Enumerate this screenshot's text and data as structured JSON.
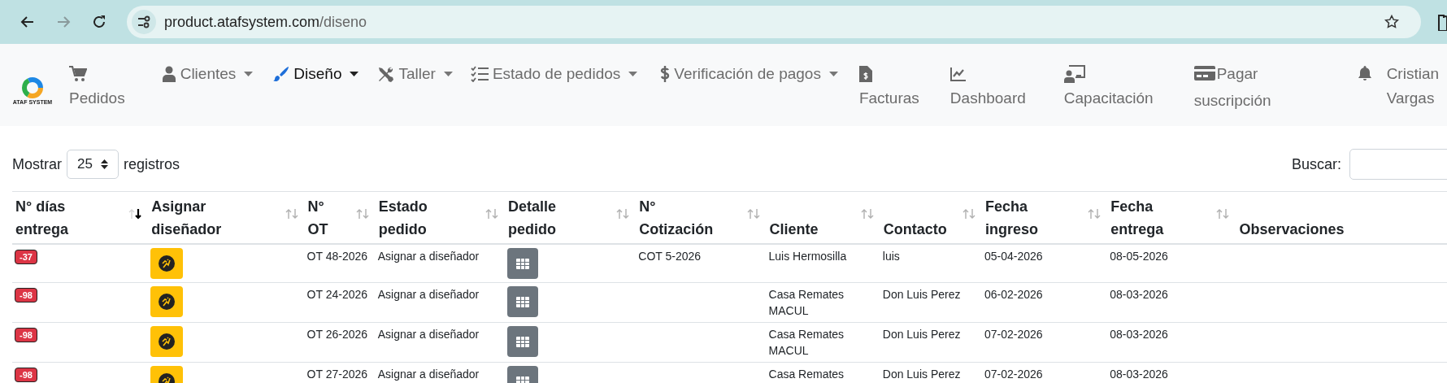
{
  "browser": {
    "url_host": "product.atafsystem.com",
    "url_path": "/diseno",
    "forward_disabled": true
  },
  "logo": {
    "text": "ATAF SYSTEM"
  },
  "nav": [
    {
      "kind": "stacked",
      "label": "Pedidos",
      "selected": false
    },
    {
      "kind": "dropdown",
      "label": "Clientes",
      "selected": false
    },
    {
      "kind": "dropdown",
      "label": "Diseño",
      "selected": true
    },
    {
      "kind": "dropdown",
      "label": "Taller",
      "selected": false
    },
    {
      "kind": "dropdown",
      "label": "Estado de pedidos",
      "selected": false
    },
    {
      "kind": "dropdown",
      "label": "Verificación de pagos",
      "selected": false
    },
    {
      "kind": "stacked",
      "label": "Facturas",
      "selected": false
    },
    {
      "kind": "stacked",
      "label": "Dashboard",
      "selected": false
    },
    {
      "kind": "stacked",
      "label": "Capacitación",
      "selected": false
    },
    {
      "kind": "wrap",
      "label": "Pagar suscripción",
      "selected": false
    },
    {
      "kind": "user",
      "label": "Cristian Vargas",
      "selected": false
    }
  ],
  "length_control": {
    "before": "Mostrar",
    "value": "25",
    "after": "registros"
  },
  "search": {
    "label": "Buscar:"
  },
  "table": {
    "columns": [
      {
        "label": "N° días\nentrega",
        "sortable": true,
        "sorted": true
      },
      {
        "label": "Asignar\ndiseñador",
        "sortable": true,
        "sorted": false
      },
      {
        "label": "N°\nOT",
        "sortable": true,
        "sorted": false
      },
      {
        "label": "Estado\npedido",
        "sortable": true,
        "sorted": false
      },
      {
        "label": "Detalle\npedido",
        "sortable": true,
        "sorted": false
      },
      {
        "label": "N°\nCotización",
        "sortable": true,
        "sorted": false
      },
      {
        "label": "Cliente",
        "sortable": true,
        "sorted": false
      },
      {
        "label": "Contacto",
        "sortable": true,
        "sorted": false
      },
      {
        "label": "Fecha\ningreso",
        "sortable": true,
        "sorted": false
      },
      {
        "label": "Fecha\nentrega",
        "sortable": true,
        "sorted": false
      },
      {
        "label": "Observaciones",
        "sortable": false
      }
    ],
    "rows": [
      {
        "days": "-37",
        "ot": "OT 48-2026",
        "status": "Asignar a diseñador",
        "quote": "COT 5-2026",
        "client": "Luis Hermosilla",
        "contact": "luis",
        "date_in": "05-04-2026",
        "date_due": "08-05-2026"
      },
      {
        "days": "-98",
        "ot": "OT 24-2026",
        "status": "Asignar a diseñador",
        "client": "Casa Remates MACUL",
        "contact": "Don Luis Perez",
        "date_in": "06-02-2026",
        "date_due": "08-03-2026"
      },
      {
        "days": "-98",
        "ot": "OT 26-2026",
        "status": "Asignar a diseñador",
        "client": "Casa Remates MACUL",
        "contact": "Don Luis Perez",
        "date_in": "07-02-2026",
        "date_due": "08-03-2026"
      },
      {
        "days": "-98",
        "ot": "OT 27-2026",
        "status": "Asignar a diseñador",
        "client": "Casa Remates",
        "contact": "Don Luis Perez",
        "date_in": "07-02-2026",
        "date_due": "08-03-2026"
      }
    ]
  }
}
